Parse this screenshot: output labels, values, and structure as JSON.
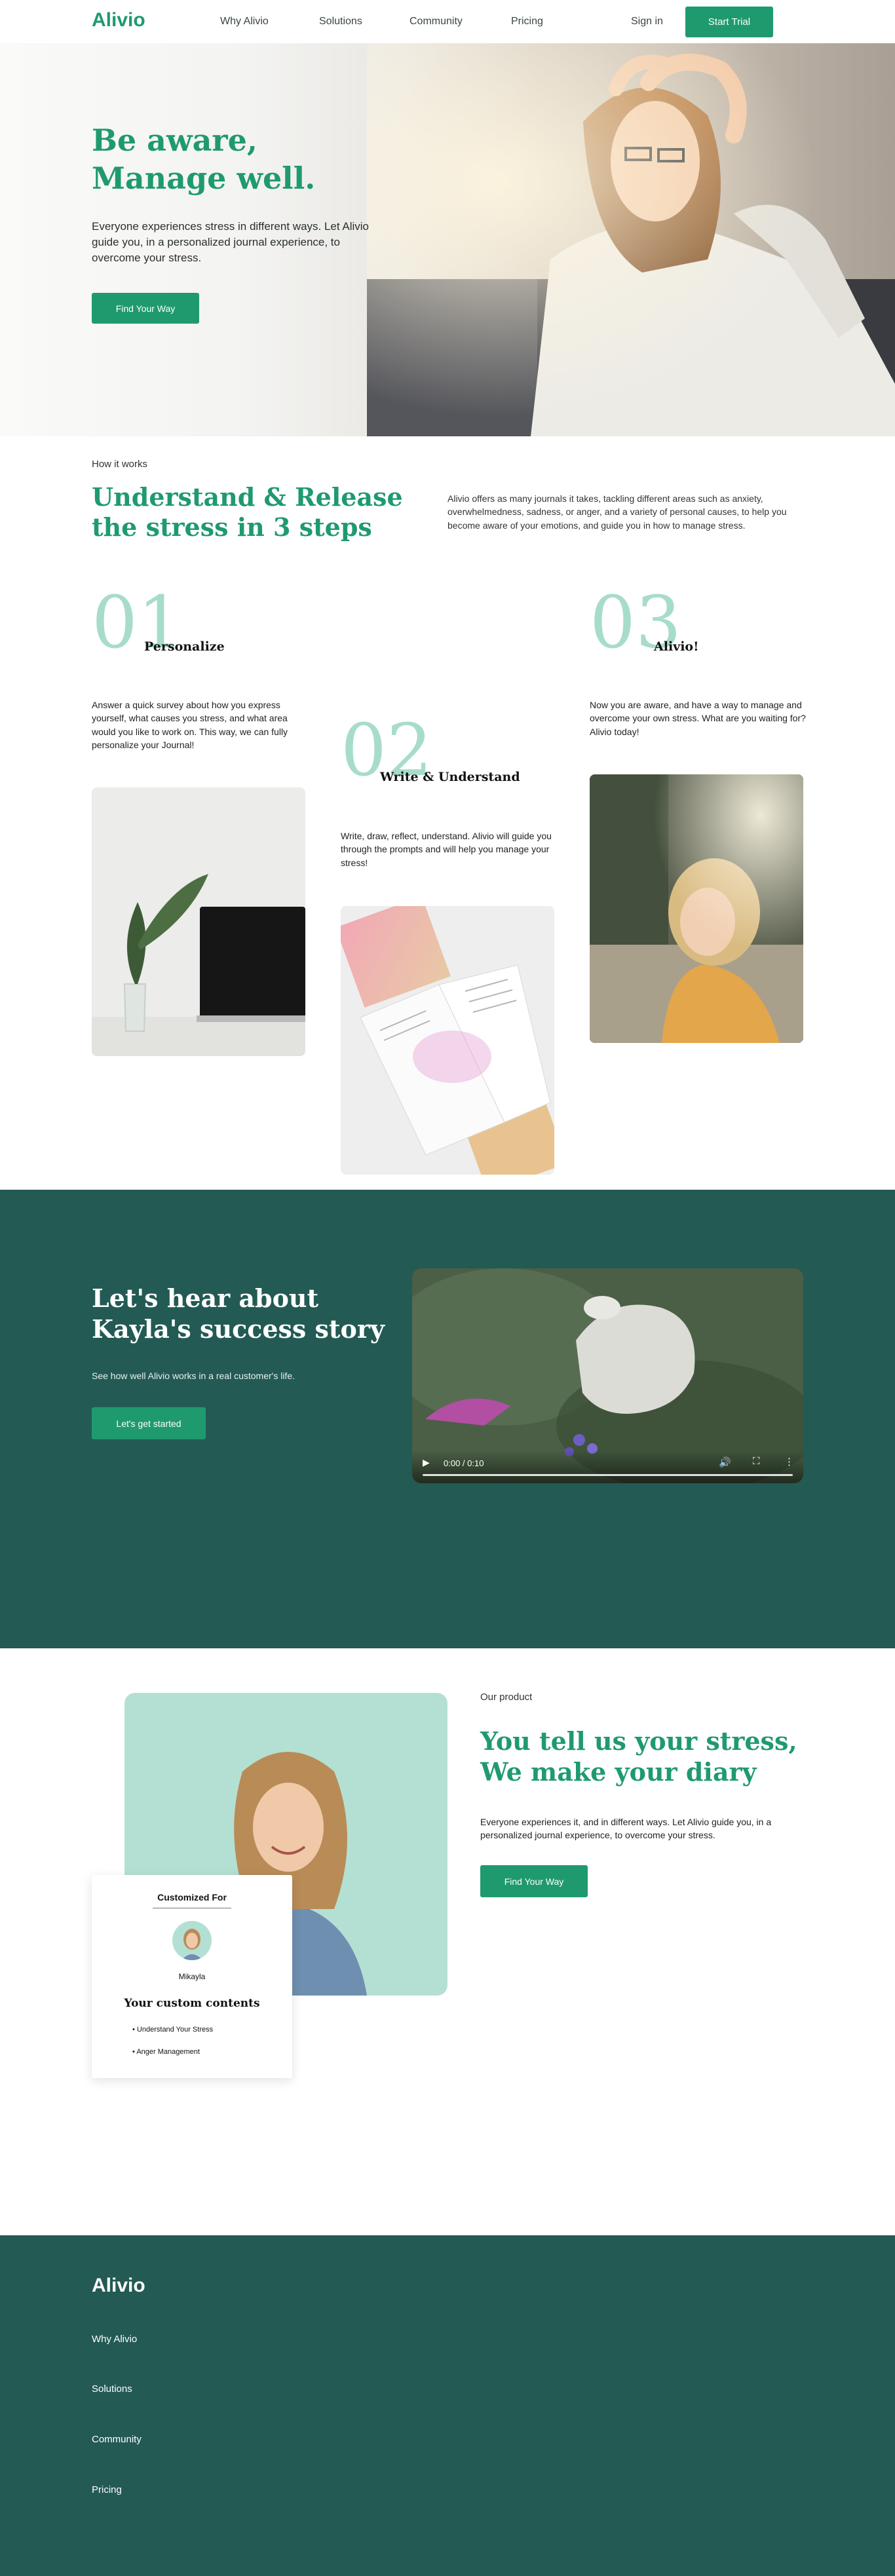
{
  "nav": {
    "logo": "Alivio",
    "links": [
      "Why Alivio",
      "Solutions",
      "Community",
      "Pricing"
    ],
    "signin": "Sign in",
    "start_trial": "Start Trial"
  },
  "hero": {
    "title_line1": "Be aware,",
    "title_line2": "Manage well.",
    "description": "Everyone experiences stress in different ways. Let Alivio guide you, in a personalized journal experience, to overcome your stress.",
    "cta": "Find Your Way"
  },
  "how": {
    "kicker": "How it works",
    "title": "Understand & Release the stress in 3 steps",
    "description": "Alivio offers as many journals it takes, tackling different areas such as anxiety, overwhelmedness, sadness, or anger, and a variety of personal causes, to help you become aware of your emotions, and guide you in how to manage stress.",
    "steps": [
      {
        "number": "01",
        "label": "Personalize",
        "description": "Answer a quick survey about how you express yourself, what causes you stress, and what area would you like to work on. This way, we can fully personalize your Journal!"
      },
      {
        "number": "02",
        "label": "Write & Understand",
        "description": "Write, draw, reflect, understand. Alivio will guide you through the prompts and will help you manage your stress!"
      },
      {
        "number": "03",
        "label": "Alivio!",
        "description": "Now you are aware, and have a way to manage and overcome your own stress. What are you waiting for? Alivio today!"
      }
    ]
  },
  "story": {
    "title": "Let's hear about Kayla's success story",
    "subtitle": "See how well Alivio works in a real customer's life.",
    "cta": "Let's get started",
    "video": {
      "time": "0:00 / 0:10",
      "progress": 0
    }
  },
  "product": {
    "kicker": "Our product",
    "title": "You tell us your stress, We make your diary",
    "description": "Everyone experiences it, and in different ways. Let Alivio guide you, in a personalized journal experience, to overcome your stress.",
    "cta": "Find Your Way",
    "card": {
      "heading": "Customized For",
      "name": "Mikayla",
      "contents_title": "Your custom contents",
      "items": [
        "Understand Your Stress",
        "Anger Management"
      ]
    }
  },
  "footer": {
    "logo": "Alivio",
    "links": [
      "Why Alivio",
      "Solutions",
      "Community",
      "Pricing"
    ]
  },
  "colors": {
    "brand_green": "#1f9a6f",
    "dark_teal": "#235a54",
    "mint": "#b4e0d3",
    "step_number": "#a7dccb"
  }
}
